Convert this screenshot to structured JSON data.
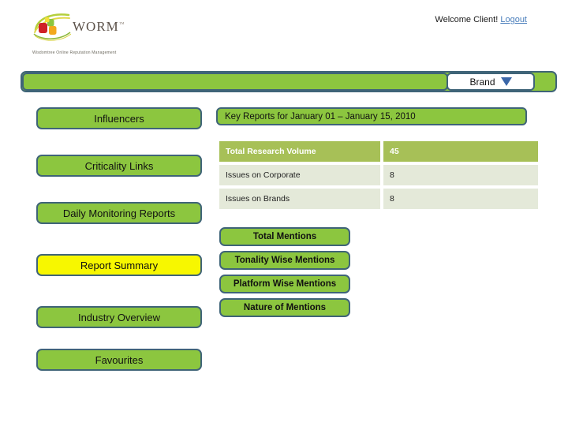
{
  "header": {
    "logo": {
      "wordmark": "WORM",
      "trademark": "™",
      "tagline": "Wisdomtree Online Reputation Management"
    },
    "welcome_text": "Welcome Client!",
    "logout_label": "Logout"
  },
  "brandbar": {
    "select_label": "Brand",
    "caret_icon": "chevron-down-icon"
  },
  "sidebar": {
    "items": [
      {
        "label": "Influencers",
        "active": false
      },
      {
        "label": "Criticality Links",
        "active": false
      },
      {
        "label": "Daily Monitoring Reports",
        "active": false
      },
      {
        "label": "Report Summary",
        "active": true
      },
      {
        "label": "Industry Overview",
        "active": false
      },
      {
        "label": "Favourites",
        "active": false
      }
    ]
  },
  "main": {
    "key_reports_title": "Key Reports for January 01 – January 15, 2010",
    "table": {
      "rows": [
        {
          "label": "Total Research Volume",
          "value": "45",
          "emphasis": true
        },
        {
          "label": "Issues on Corporate",
          "value": "8",
          "emphasis": false
        },
        {
          "label": "Issues on Brands",
          "value": "8",
          "emphasis": false
        }
      ]
    },
    "report_buttons": [
      {
        "label": "Total Mentions"
      },
      {
        "label": "Tonality Wise Mentions"
      },
      {
        "label": "Platform Wise Mentions"
      },
      {
        "label": "Nature of Mentions"
      }
    ]
  },
  "colors": {
    "green": "#8cc63f",
    "border": "#3f6478",
    "active_yellow": "#f7f700",
    "table_head": "#a7c057",
    "table_body": "#e4e9d9",
    "link_blue": "#4a7ebb"
  }
}
